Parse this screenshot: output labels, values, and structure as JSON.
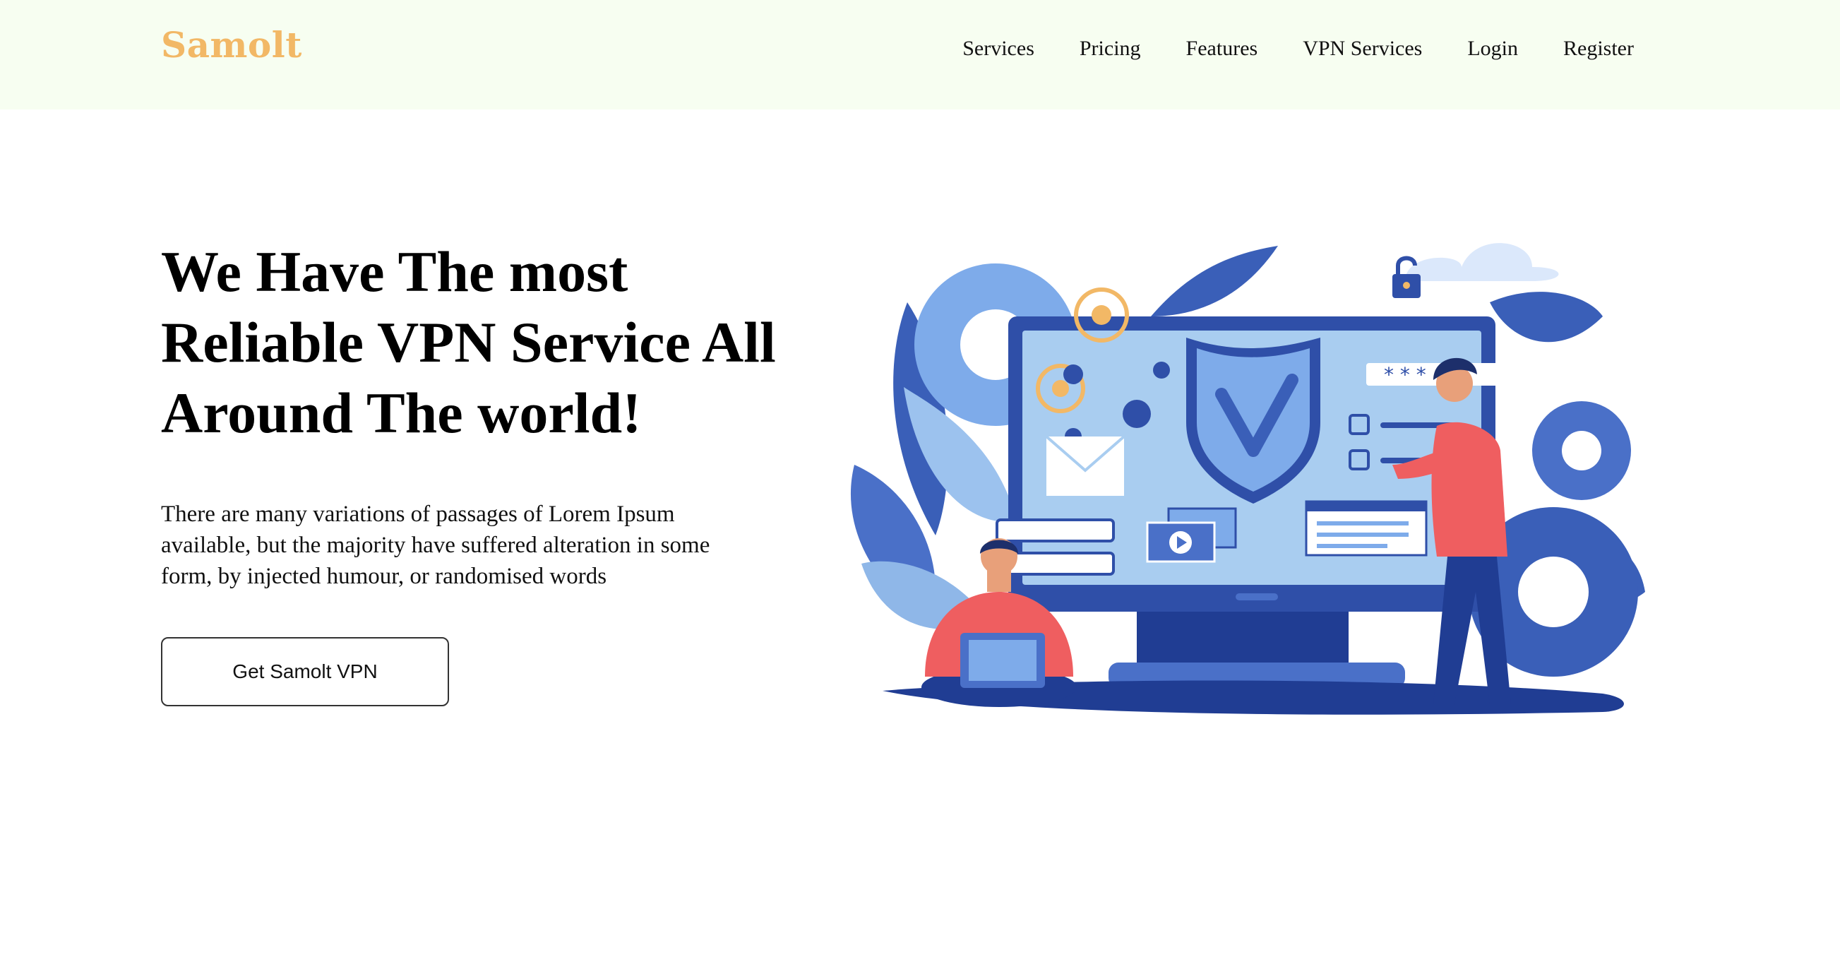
{
  "brand": {
    "name": "Samolt"
  },
  "nav": {
    "items": [
      "Services",
      "Pricing",
      "Features",
      "VPN Services",
      "Login",
      "Register"
    ]
  },
  "hero": {
    "title": "We Have The most Reliable VPN Service All Around The world!",
    "description": "There are many variations of passages of Lorem Ipsum available, but the majority have suffered alteration in some form, by injected humour, or randomised words",
    "cta_label": "Get Samolt VPN"
  },
  "colors": {
    "nav_background": "#f7fef1",
    "brand": "#f2b866",
    "illustration_primary": "#2f4fa8",
    "illustration_light": "#a9cdf0",
    "accent": "#ef5e60"
  },
  "illustration": {
    "icons": [
      "gear-icon",
      "target-icon",
      "skull-icon",
      "lock-icon",
      "cloud-icon",
      "shield-icon",
      "envelope-icon",
      "password-field-icon",
      "checkbox-icon",
      "video-icon",
      "browser-window-icon",
      "laptop-icon"
    ]
  }
}
